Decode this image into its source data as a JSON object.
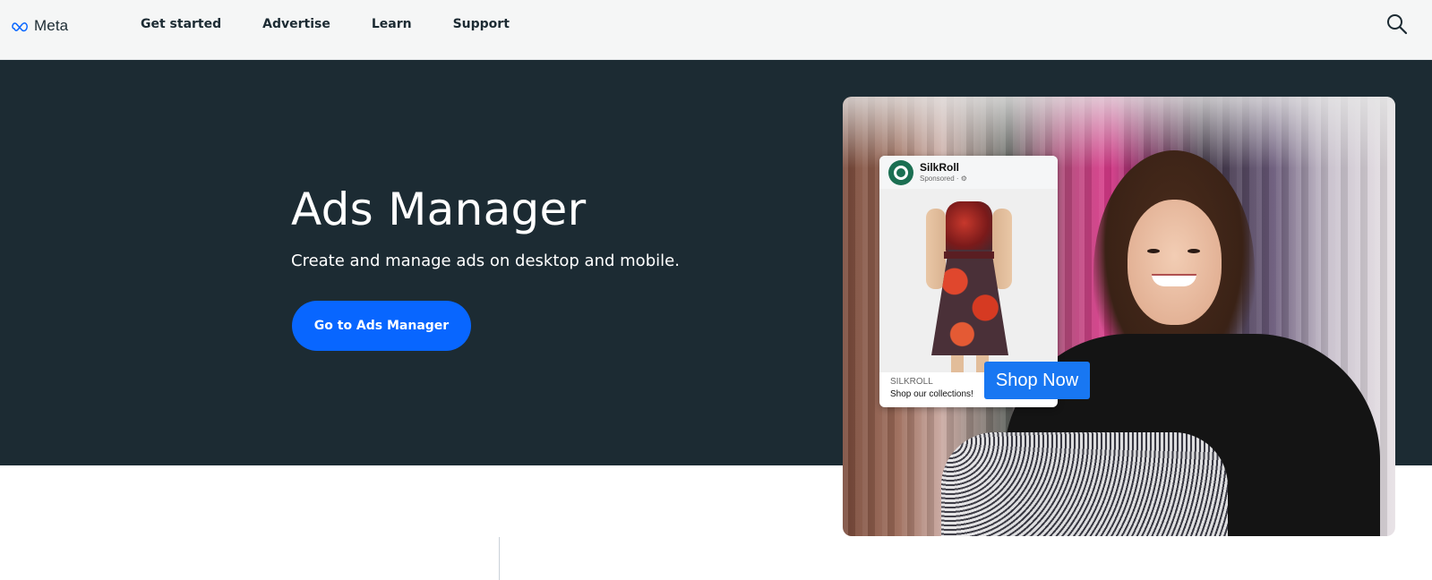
{
  "nav": {
    "logo_text": "Meta",
    "links": [
      "Get started",
      "Advertise",
      "Learn",
      "Support"
    ]
  },
  "hero": {
    "title": "Ads Manager",
    "subtitle": "Create and manage ads on desktop and mobile.",
    "cta_label": "Go to Ads Manager"
  },
  "ad_preview": {
    "account_name": "SilkRoll",
    "sponsored_label": "Sponsored · ⚙",
    "brand": "SILKROLL",
    "tagline": "Shop our collections!",
    "cta_label": "Shop Now"
  },
  "colors": {
    "nav_bg": "#f5f6f6",
    "hero_bg": "#1c2b33",
    "cta": "#0866ff",
    "shop_now": "#1877f2"
  },
  "icons": {
    "logo": "meta-infinity-icon",
    "search": "search-icon"
  }
}
